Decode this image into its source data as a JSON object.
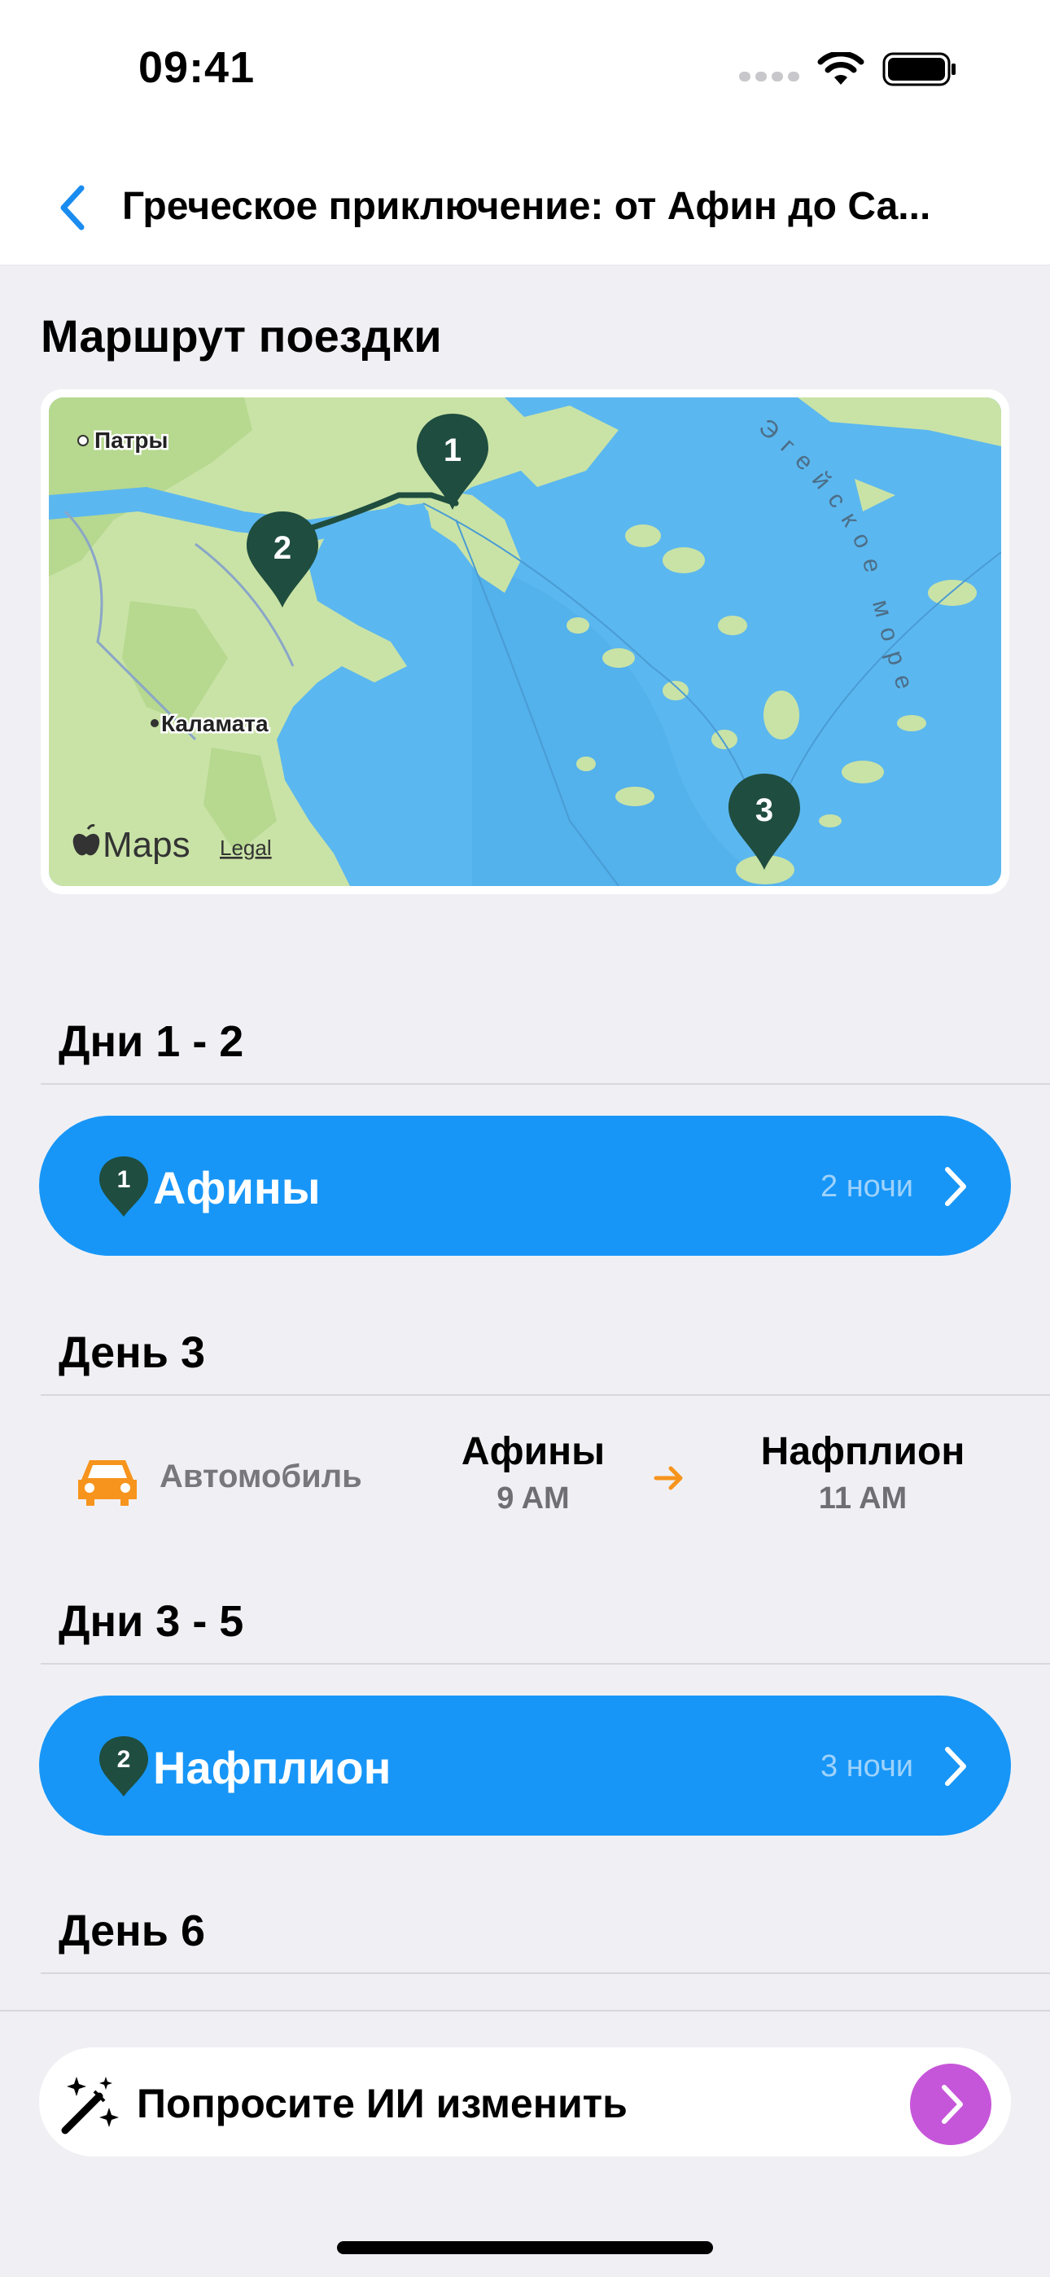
{
  "status_bar": {
    "time": "09:41"
  },
  "nav": {
    "title": "Греческое приключение: от Афин до Са..."
  },
  "route_section": {
    "title": "Маршрут поездки"
  },
  "map": {
    "labels": {
      "patras": "Патры",
      "kalamata": "Каламата",
      "sea": "Эгейское море",
      "brand": "Maps",
      "legal": "Legal"
    },
    "pins": [
      "1",
      "2",
      "3"
    ],
    "pin_color": "#1F4D3F"
  },
  "itinerary": [
    {
      "header": "Дни 1 - 2",
      "type": "stay",
      "pin": "1",
      "city": "Афины",
      "nights": "2 ночи"
    },
    {
      "header": "День 3",
      "type": "transport",
      "mode": "Автомобиль",
      "from_city": "Афины",
      "from_time": "9 AM",
      "to_city": "Нафплион",
      "to_time": "11 AM"
    },
    {
      "header": "Дни 3 - 5",
      "type": "stay",
      "pin": "2",
      "city": "Нафплион",
      "nights": "3 ночи"
    },
    {
      "header": "День 6"
    }
  ],
  "ai_bar": {
    "label": "Попросите ИИ изменить"
  },
  "colors": {
    "accent_blue": "#1796F7",
    "ai_purple": "#C656D9",
    "car_orange": "#F7941D",
    "back_blue": "#1A8CF0"
  },
  "icons": {
    "back": "chevron-left-icon",
    "pin": "map-pin-icon",
    "chevron": "chevron-right-icon",
    "car": "car-icon",
    "arrow": "arrow-right-icon",
    "wand": "magic-wand-icon"
  }
}
